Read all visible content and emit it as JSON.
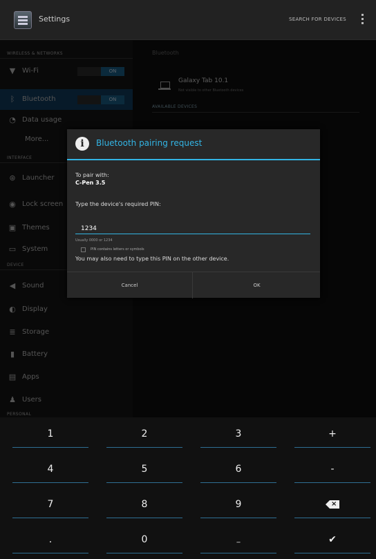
{
  "action_bar": {
    "title": "Settings",
    "search_label": "SEARCH FOR DEVICES",
    "icon": "settings-app-icon",
    "overflow_icon": "overflow-menu-icon"
  },
  "left_pane": {
    "wireless_header": "WIRELESS & NETWORKS",
    "wifi": {
      "label": "Wi-Fi",
      "toggle": "ON",
      "icon": "wifi-icon"
    },
    "bluetooth": {
      "label": "Bluetooth",
      "toggle": "ON",
      "icon": "bluetooth-icon"
    },
    "data_usage": {
      "label": "Data usage",
      "icon": "data-usage-icon"
    },
    "more": {
      "label": "More..."
    },
    "interface_header": "INTERFACE",
    "launcher": {
      "label": "Launcher",
      "icon": "launcher-icon"
    },
    "lock_screen": {
      "label": "Lock screen",
      "icon": "lock-screen-icon"
    },
    "themes": {
      "label": "Themes",
      "icon": "themes-icon"
    },
    "system": {
      "label": "System",
      "icon": "system-icon"
    },
    "device_header": "DEVICE",
    "sound": {
      "label": "Sound",
      "icon": "sound-icon"
    },
    "display": {
      "label": "Display",
      "icon": "display-icon"
    },
    "storage": {
      "label": "Storage",
      "icon": "storage-icon"
    },
    "battery": {
      "label": "Battery",
      "icon": "battery-icon"
    },
    "apps": {
      "label": "Apps",
      "icon": "apps-icon"
    },
    "users": {
      "label": "Users",
      "icon": "users-icon"
    },
    "personal_header": "PERSONAL"
  },
  "right_pane": {
    "header": "Bluetooth",
    "device_name": "Galaxy Tab 10.1",
    "device_status": "Not visible to other Bluetooth devices",
    "available_header": "AVAILABLE DEVICES"
  },
  "dialog": {
    "title": "Bluetooth pairing request",
    "pair_with_label": "To pair with:",
    "device": "C-Pen 3.5",
    "type_pin_label": "Type the device's required PIN:",
    "pin_value": "1234",
    "pin_hint": "Usually 0000 or 1234",
    "checkbox_label": "PIN contains letters or symbols",
    "also_type_note": "You may also need to type this PIN on the other device.",
    "cancel_label": "Cancel",
    "ok_label": "OK",
    "accent_color": "#33b5e5"
  },
  "keyboard": {
    "keys": [
      "1",
      "2",
      "3",
      "+",
      "4",
      "5",
      "6",
      "-",
      "7",
      "8",
      "9",
      "⌫",
      ".",
      "0",
      "_",
      "✔"
    ]
  }
}
